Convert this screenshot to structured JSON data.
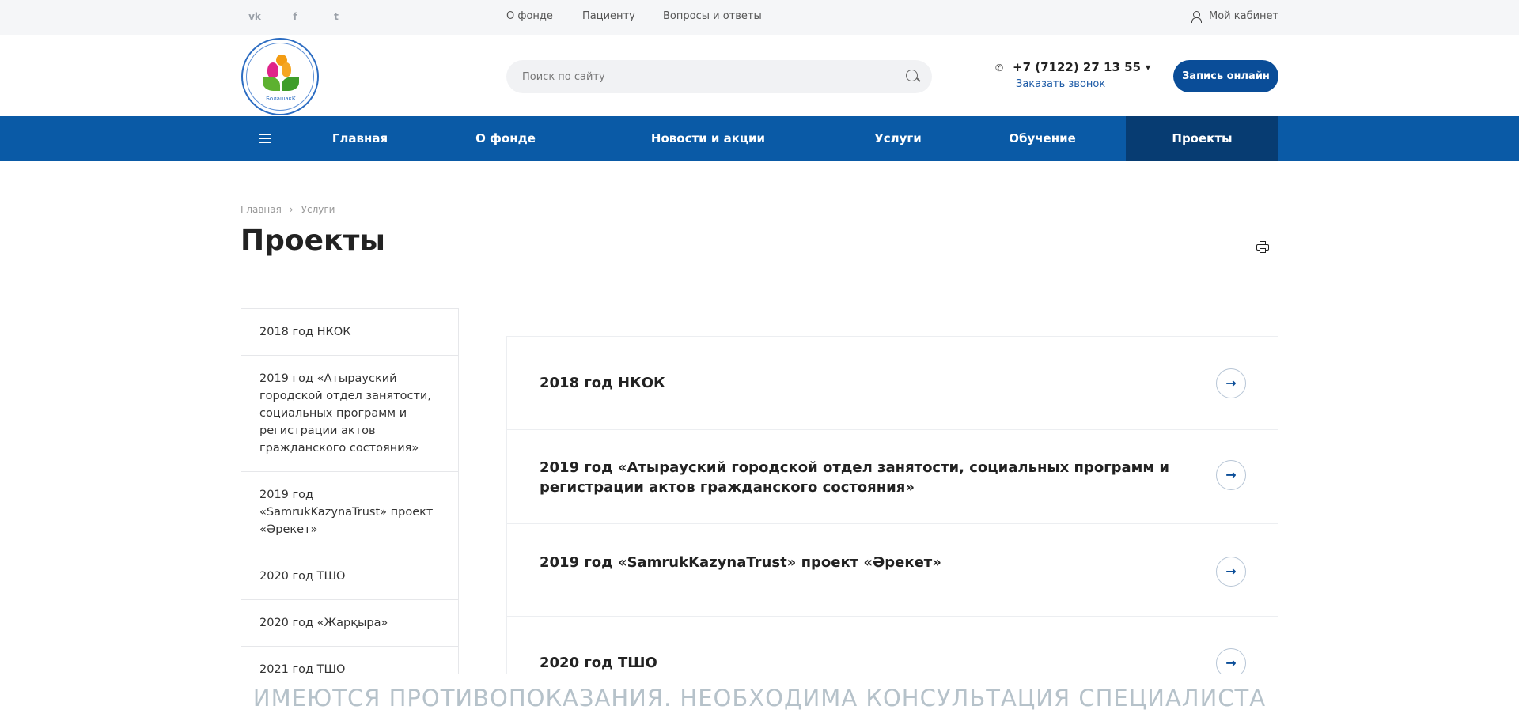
{
  "topbar": {
    "social": [
      {
        "icon": "vk-icon",
        "glyph": "vk"
      },
      {
        "icon": "facebook-icon",
        "glyph": "f"
      },
      {
        "icon": "twitter-icon",
        "glyph": "t"
      }
    ],
    "links": [
      "О фонде",
      "Пациенту",
      "Вопросы и ответы"
    ],
    "cabinet_label": "Мой кабинет"
  },
  "header": {
    "logo_text": "БолашакК",
    "search_placeholder": "Поиск по сайту",
    "phone": "+7 (7122) 27 13 55",
    "callback_label": "Заказать звонок",
    "book_label": "Запись онлайн"
  },
  "nav": {
    "items": [
      "Главная",
      "О фонде",
      "Новости и акции",
      "Услуги",
      "Обучение",
      "Проекты"
    ],
    "active": "Проекты"
  },
  "breadcrumb": {
    "home": "Главная",
    "separator": "›",
    "current": "Услуги"
  },
  "page": {
    "title": "Проекты"
  },
  "sidebar": {
    "items": [
      "2018 год НКОК",
      "2019 год «Атырауский городской отдел занятости, социальных программ и регистрации актов гражданского состояния»",
      "2019 год «SamrukKazynaTrust» проект «Әрекет»",
      "2020 год ТШО",
      "2020 год «Жарқыра»",
      "2021 год ТШО"
    ]
  },
  "cards": {
    "items": [
      "2018 год НКОК",
      "2019 год «Атырауский городской отдел занятости, социальных программ и регистрации актов гражданского состояния»",
      "2019 год «SamrukKazynaTrust» проект «Әрекет»",
      "2020 год ТШО"
    ],
    "arrow_glyph": "→"
  },
  "footer": {
    "warning": "ИМЕЮТСЯ ПРОТИВОПОКАЗАНИЯ. НЕОБХОДИМА КОНСУЛЬТАЦИЯ СПЕЦИАЛИСТА"
  },
  "colors": {
    "brand_blue": "#0a5aa6",
    "active_nav": "#073c72",
    "button_blue": "#0a4d98",
    "link_blue": "#1c5aa6"
  }
}
